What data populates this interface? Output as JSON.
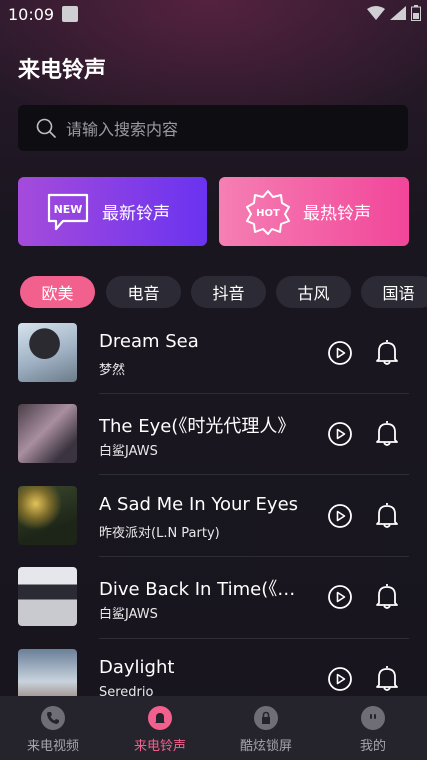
{
  "status_bar": {
    "time": "10:09"
  },
  "header": {
    "title": "来电铃声"
  },
  "search": {
    "placeholder": "请输入搜索内容"
  },
  "cards": [
    {
      "badge": "NEW",
      "label": "最新铃声"
    },
    {
      "badge": "HOT",
      "label": "最热铃声"
    }
  ],
  "tabs": [
    {
      "label": "欧美",
      "active": true
    },
    {
      "label": "电音"
    },
    {
      "label": "抖音"
    },
    {
      "label": "古风"
    },
    {
      "label": "国语"
    }
  ],
  "songs": [
    {
      "title": "Dream Sea",
      "artist": "梦然"
    },
    {
      "title": "The Eye(《时光代理人》",
      "artist": "白鲨JAWS"
    },
    {
      "title": "A Sad Me In Your Eyes",
      "artist": "昨夜派对(L.N Party)"
    },
    {
      "title": "Dive Back In Time(《时光代理人》",
      "artist": "白鲨JAWS"
    },
    {
      "title": "Daylight",
      "artist": "Seredrio"
    }
  ],
  "bottom_nav": [
    {
      "label": "来电视频"
    },
    {
      "label": "来电铃声",
      "active": true
    },
    {
      "label": "酷炫锁屏"
    },
    {
      "label": "我的"
    }
  ],
  "colors": {
    "accent": "#f2618e",
    "new_card": "#7a3ae8",
    "hot_card": "#f2469a"
  }
}
